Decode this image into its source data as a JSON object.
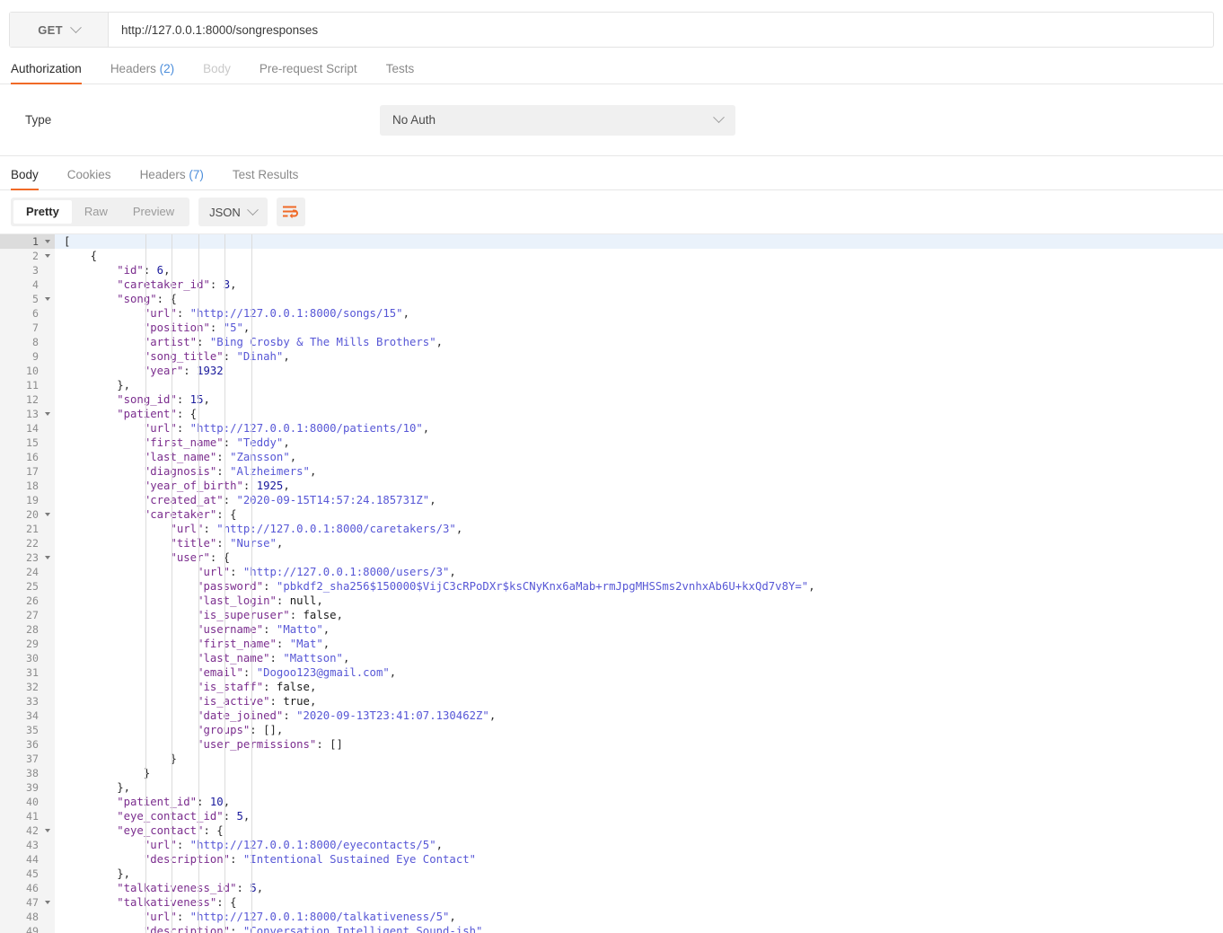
{
  "request": {
    "method": "GET",
    "url": "http://127.0.0.1:8000/songresponses",
    "tabs": [
      {
        "label": "Authorization",
        "count": "",
        "state": "active"
      },
      {
        "label": "Headers",
        "count": "(2)",
        "state": "normal"
      },
      {
        "label": "Body",
        "count": "",
        "state": "disabled"
      },
      {
        "label": "Pre-request Script",
        "count": "",
        "state": "normal"
      },
      {
        "label": "Tests",
        "count": "",
        "state": "normal"
      }
    ]
  },
  "authorization": {
    "type_label": "Type",
    "type_value": "No Auth"
  },
  "response": {
    "tabs": [
      {
        "label": "Body",
        "count": "",
        "state": "active"
      },
      {
        "label": "Cookies",
        "count": "",
        "state": "normal"
      },
      {
        "label": "Headers",
        "count": "(7)",
        "state": "normal"
      },
      {
        "label": "Test Results",
        "count": "",
        "state": "normal"
      }
    ],
    "view_modes": [
      {
        "label": "Pretty",
        "state": "active"
      },
      {
        "label": "Raw",
        "state": "normal"
      },
      {
        "label": "Preview",
        "state": "normal"
      }
    ],
    "format": "JSON",
    "wrap_icon": "wrap-lines-icon"
  },
  "colors": {
    "accent": "#f06a27",
    "link": "#4b8ddb",
    "json_key": "#7b2d8e",
    "json_string": "#5757d6",
    "json_number": "#1a1a9c",
    "active_line": "#eaf2fb"
  },
  "code": {
    "active_line": 1,
    "lines": [
      {
        "n": 1,
        "fold": true,
        "tokens": [
          [
            "p",
            "["
          ]
        ]
      },
      {
        "n": 2,
        "fold": true,
        "tokens": [
          [
            "p",
            "    {"
          ]
        ]
      },
      {
        "n": 3,
        "fold": false,
        "tokens": [
          [
            "k",
            "        \"id\""
          ],
          [
            "p",
            ": "
          ],
          [
            "n",
            "6"
          ],
          [
            "p",
            ","
          ]
        ]
      },
      {
        "n": 4,
        "fold": false,
        "tokens": [
          [
            "k",
            "        \"caretaker_id\""
          ],
          [
            "p",
            ": "
          ],
          [
            "n",
            "3"
          ],
          [
            "p",
            ","
          ]
        ]
      },
      {
        "n": 5,
        "fold": true,
        "tokens": [
          [
            "k",
            "        \"song\""
          ],
          [
            "p",
            ": {"
          ]
        ]
      },
      {
        "n": 6,
        "fold": false,
        "tokens": [
          [
            "k",
            "            \"url\""
          ],
          [
            "p",
            ": "
          ],
          [
            "s",
            "\"http://127.0.0.1:8000/songs/15\""
          ],
          [
            "p",
            ","
          ]
        ]
      },
      {
        "n": 7,
        "fold": false,
        "tokens": [
          [
            "k",
            "            \"position\""
          ],
          [
            "p",
            ": "
          ],
          [
            "s",
            "\"5\""
          ],
          [
            "p",
            ","
          ]
        ]
      },
      {
        "n": 8,
        "fold": false,
        "tokens": [
          [
            "k",
            "            \"artist\""
          ],
          [
            "p",
            ": "
          ],
          [
            "s",
            "\"Bing Crosby & The Mills Brothers\""
          ],
          [
            "p",
            ","
          ]
        ]
      },
      {
        "n": 9,
        "fold": false,
        "tokens": [
          [
            "k",
            "            \"song_title\""
          ],
          [
            "p",
            ": "
          ],
          [
            "s",
            "\"Dinah\""
          ],
          [
            "p",
            ","
          ]
        ]
      },
      {
        "n": 10,
        "fold": false,
        "tokens": [
          [
            "k",
            "            \"year\""
          ],
          [
            "p",
            ": "
          ],
          [
            "n",
            "1932"
          ]
        ]
      },
      {
        "n": 11,
        "fold": false,
        "tokens": [
          [
            "p",
            "        },"
          ]
        ]
      },
      {
        "n": 12,
        "fold": false,
        "tokens": [
          [
            "k",
            "        \"song_id\""
          ],
          [
            "p",
            ": "
          ],
          [
            "n",
            "15"
          ],
          [
            "p",
            ","
          ]
        ]
      },
      {
        "n": 13,
        "fold": true,
        "tokens": [
          [
            "k",
            "        \"patient\""
          ],
          [
            "p",
            ": {"
          ]
        ]
      },
      {
        "n": 14,
        "fold": false,
        "tokens": [
          [
            "k",
            "            \"url\""
          ],
          [
            "p",
            ": "
          ],
          [
            "s",
            "\"http://127.0.0.1:8000/patients/10\""
          ],
          [
            "p",
            ","
          ]
        ]
      },
      {
        "n": 15,
        "fold": false,
        "tokens": [
          [
            "k",
            "            \"first_name\""
          ],
          [
            "p",
            ": "
          ],
          [
            "s",
            "\"Teddy\""
          ],
          [
            "p",
            ","
          ]
        ]
      },
      {
        "n": 16,
        "fold": false,
        "tokens": [
          [
            "k",
            "            \"last_name\""
          ],
          [
            "p",
            ": "
          ],
          [
            "s",
            "\"Zansson\""
          ],
          [
            "p",
            ","
          ]
        ]
      },
      {
        "n": 17,
        "fold": false,
        "tokens": [
          [
            "k",
            "            \"diagnosis\""
          ],
          [
            "p",
            ": "
          ],
          [
            "s",
            "\"Alzheimers\""
          ],
          [
            "p",
            ","
          ]
        ]
      },
      {
        "n": 18,
        "fold": false,
        "tokens": [
          [
            "k",
            "            \"year_of_birth\""
          ],
          [
            "p",
            ": "
          ],
          [
            "n",
            "1925"
          ],
          [
            "p",
            ","
          ]
        ]
      },
      {
        "n": 19,
        "fold": false,
        "tokens": [
          [
            "k",
            "            \"created_at\""
          ],
          [
            "p",
            ": "
          ],
          [
            "s",
            "\"2020-09-15T14:57:24.185731Z\""
          ],
          [
            "p",
            ","
          ]
        ]
      },
      {
        "n": 20,
        "fold": true,
        "tokens": [
          [
            "k",
            "            \"caretaker\""
          ],
          [
            "p",
            ": {"
          ]
        ]
      },
      {
        "n": 21,
        "fold": false,
        "tokens": [
          [
            "k",
            "                \"url\""
          ],
          [
            "p",
            ": "
          ],
          [
            "s",
            "\"http://127.0.0.1:8000/caretakers/3\""
          ],
          [
            "p",
            ","
          ]
        ]
      },
      {
        "n": 22,
        "fold": false,
        "tokens": [
          [
            "k",
            "                \"title\""
          ],
          [
            "p",
            ": "
          ],
          [
            "s",
            "\"Nurse\""
          ],
          [
            "p",
            ","
          ]
        ]
      },
      {
        "n": 23,
        "fold": true,
        "tokens": [
          [
            "k",
            "                \"user\""
          ],
          [
            "p",
            ": {"
          ]
        ]
      },
      {
        "n": 24,
        "fold": false,
        "tokens": [
          [
            "k",
            "                    \"url\""
          ],
          [
            "p",
            ": "
          ],
          [
            "s",
            "\"http://127.0.0.1:8000/users/3\""
          ],
          [
            "p",
            ","
          ]
        ]
      },
      {
        "n": 25,
        "fold": false,
        "tokens": [
          [
            "k",
            "                    \"password\""
          ],
          [
            "p",
            ": "
          ],
          [
            "s",
            "\"pbkdf2_sha256$150000$VijC3cRPoDXr$ksCNyKnx6aMab+rmJpgMHSSms2vnhxAb6U+kxQd7v8Y=\""
          ],
          [
            "p",
            ","
          ]
        ]
      },
      {
        "n": 26,
        "fold": false,
        "tokens": [
          [
            "k",
            "                    \"last_login\""
          ],
          [
            "p",
            ": "
          ],
          [
            "b",
            "null"
          ],
          [
            "p",
            ","
          ]
        ]
      },
      {
        "n": 27,
        "fold": false,
        "tokens": [
          [
            "k",
            "                    \"is_superuser\""
          ],
          [
            "p",
            ": "
          ],
          [
            "b",
            "false"
          ],
          [
            "p",
            ","
          ]
        ]
      },
      {
        "n": 28,
        "fold": false,
        "tokens": [
          [
            "k",
            "                    \"username\""
          ],
          [
            "p",
            ": "
          ],
          [
            "s",
            "\"Matto\""
          ],
          [
            "p",
            ","
          ]
        ]
      },
      {
        "n": 29,
        "fold": false,
        "tokens": [
          [
            "k",
            "                    \"first_name\""
          ],
          [
            "p",
            ": "
          ],
          [
            "s",
            "\"Mat\""
          ],
          [
            "p",
            ","
          ]
        ]
      },
      {
        "n": 30,
        "fold": false,
        "tokens": [
          [
            "k",
            "                    \"last_name\""
          ],
          [
            "p",
            ": "
          ],
          [
            "s",
            "\"Mattson\""
          ],
          [
            "p",
            ","
          ]
        ]
      },
      {
        "n": 31,
        "fold": false,
        "tokens": [
          [
            "k",
            "                    \"email\""
          ],
          [
            "p",
            ": "
          ],
          [
            "s",
            "\"Dogoo123@gmail.com\""
          ],
          [
            "p",
            ","
          ]
        ]
      },
      {
        "n": 32,
        "fold": false,
        "tokens": [
          [
            "k",
            "                    \"is_staff\""
          ],
          [
            "p",
            ": "
          ],
          [
            "b",
            "false"
          ],
          [
            "p",
            ","
          ]
        ]
      },
      {
        "n": 33,
        "fold": false,
        "tokens": [
          [
            "k",
            "                    \"is_active\""
          ],
          [
            "p",
            ": "
          ],
          [
            "b",
            "true"
          ],
          [
            "p",
            ","
          ]
        ]
      },
      {
        "n": 34,
        "fold": false,
        "tokens": [
          [
            "k",
            "                    \"date_joined\""
          ],
          [
            "p",
            ": "
          ],
          [
            "s",
            "\"2020-09-13T23:41:07.130462Z\""
          ],
          [
            "p",
            ","
          ]
        ]
      },
      {
        "n": 35,
        "fold": false,
        "tokens": [
          [
            "k",
            "                    \"groups\""
          ],
          [
            "p",
            ": [],"
          ]
        ]
      },
      {
        "n": 36,
        "fold": false,
        "tokens": [
          [
            "k",
            "                    \"user_permissions\""
          ],
          [
            "p",
            ": []"
          ]
        ]
      },
      {
        "n": 37,
        "fold": false,
        "tokens": [
          [
            "p",
            "                }"
          ]
        ]
      },
      {
        "n": 38,
        "fold": false,
        "tokens": [
          [
            "p",
            "            }"
          ]
        ]
      },
      {
        "n": 39,
        "fold": false,
        "tokens": [
          [
            "p",
            "        },"
          ]
        ]
      },
      {
        "n": 40,
        "fold": false,
        "tokens": [
          [
            "k",
            "        \"patient_id\""
          ],
          [
            "p",
            ": "
          ],
          [
            "n",
            "10"
          ],
          [
            "p",
            ","
          ]
        ]
      },
      {
        "n": 41,
        "fold": false,
        "tokens": [
          [
            "k",
            "        \"eye_contact_id\""
          ],
          [
            "p",
            ": "
          ],
          [
            "n",
            "5"
          ],
          [
            "p",
            ","
          ]
        ]
      },
      {
        "n": 42,
        "fold": true,
        "tokens": [
          [
            "k",
            "        \"eye_contact\""
          ],
          [
            "p",
            ": {"
          ]
        ]
      },
      {
        "n": 43,
        "fold": false,
        "tokens": [
          [
            "k",
            "            \"url\""
          ],
          [
            "p",
            ": "
          ],
          [
            "s",
            "\"http://127.0.0.1:8000/eyecontacts/5\""
          ],
          [
            "p",
            ","
          ]
        ]
      },
      {
        "n": 44,
        "fold": false,
        "tokens": [
          [
            "k",
            "            \"description\""
          ],
          [
            "p",
            ": "
          ],
          [
            "s",
            "\"Intentional Sustained Eye Contact\""
          ]
        ]
      },
      {
        "n": 45,
        "fold": false,
        "tokens": [
          [
            "p",
            "        },"
          ]
        ]
      },
      {
        "n": 46,
        "fold": false,
        "tokens": [
          [
            "k",
            "        \"talkativeness_id\""
          ],
          [
            "p",
            ": "
          ],
          [
            "n",
            "5"
          ],
          [
            "p",
            ","
          ]
        ]
      },
      {
        "n": 47,
        "fold": true,
        "tokens": [
          [
            "k",
            "        \"talkativeness\""
          ],
          [
            "p",
            ": {"
          ]
        ]
      },
      {
        "n": 48,
        "fold": false,
        "tokens": [
          [
            "k",
            "            \"url\""
          ],
          [
            "p",
            ": "
          ],
          [
            "s",
            "\"http://127.0.0.1:8000/talkativeness/5\""
          ],
          [
            "p",
            ","
          ]
        ]
      },
      {
        "n": 49,
        "fold": false,
        "tokens": [
          [
            "k",
            "            \"description\""
          ],
          [
            "p",
            ": "
          ],
          [
            "s",
            "\"Conversation Intelligent Sound-ish\""
          ]
        ]
      }
    ]
  }
}
